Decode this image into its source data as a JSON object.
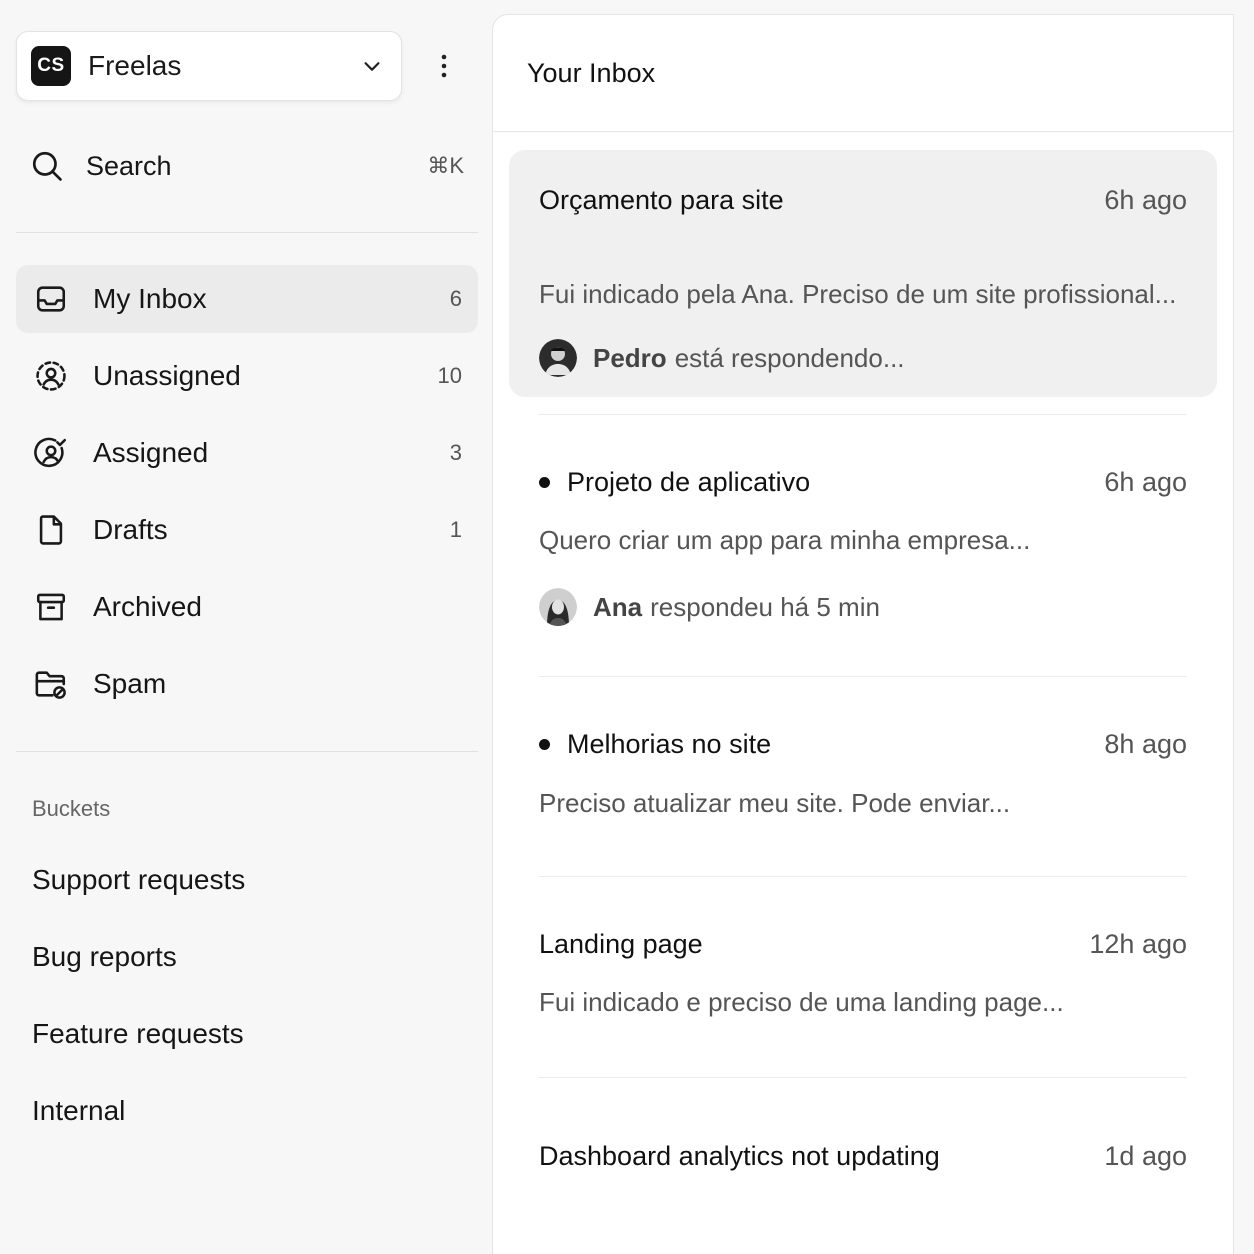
{
  "workspace": {
    "logo": "CS",
    "name": "Freelas"
  },
  "search": {
    "label": "Search",
    "shortcut": "⌘K"
  },
  "nav": [
    {
      "label": "My Inbox",
      "count": "6",
      "icon": "inbox-icon",
      "active": true
    },
    {
      "label": "Unassigned",
      "count": "10",
      "icon": "user-dashed-circle-icon"
    },
    {
      "label": "Assigned",
      "count": "3",
      "icon": "user-check-circle-icon"
    },
    {
      "label": "Drafts",
      "count": "1",
      "icon": "file-icon"
    },
    {
      "label": "Archived",
      "count": "",
      "icon": "archive-icon"
    },
    {
      "label": "Spam",
      "count": "",
      "icon": "folder-blocked-icon"
    }
  ],
  "buckets": {
    "title": "Buckets",
    "items": [
      "Support requests",
      "Bug reports",
      "Feature requests",
      "Internal"
    ]
  },
  "inbox": {
    "title": "Your Inbox",
    "conversations": [
      {
        "subject": "Orçamento para site",
        "time": "6h ago",
        "preview": "Fui indicado pela Ana. Preciso de um site profissional...",
        "activity_name": "Pedro",
        "activity_text": "está respondendo...",
        "unread": false
      },
      {
        "subject": "Projeto de aplicativo",
        "time": "6h ago",
        "preview": "Quero criar um app para minha empresa...",
        "activity_name": "Ana",
        "activity_text": "respondeu há 5 min",
        "unread": true
      },
      {
        "subject": "Melhorias no site",
        "time": "8h ago",
        "preview": "Preciso atualizar meu site. Pode enviar...",
        "unread": true
      },
      {
        "subject": "Landing page",
        "time": "12h ago",
        "preview": "Fui indicado e preciso de uma landing page...",
        "unread": false
      },
      {
        "subject": "Dashboard analytics not updating",
        "time": "1d ago",
        "unread": false
      }
    ]
  }
}
